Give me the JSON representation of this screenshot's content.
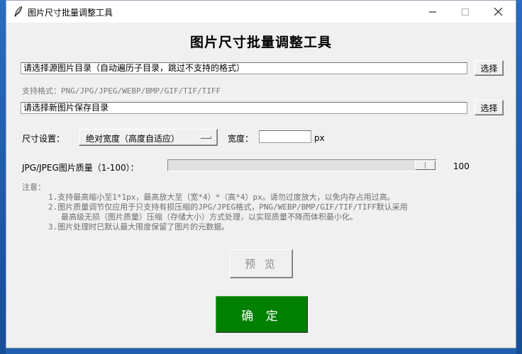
{
  "window": {
    "title": "图片尺寸批量调整工具"
  },
  "main": {
    "title": "图片尺寸批量调整工具",
    "source": {
      "value": "请选择源图片目录（自动遍历子目录，跳过不支持的格式）",
      "button_label": "选择"
    },
    "formats_hint": "支持格式：PNG/JPG/JPEG/WEBP/BMP/GIF/TIF/TIFF",
    "target": {
      "value": "请选择新图片保存目录",
      "button_label": "选择"
    },
    "size": {
      "label": "尺寸设置：",
      "mode_selected": "绝对宽度（高度自适应）",
      "width_label": "宽度：",
      "width_value": "",
      "unit": "px"
    },
    "quality": {
      "label": "JPG/JPEG图片质量（1-100）：",
      "value": 100,
      "min": 1,
      "max": 100,
      "value_text": "100"
    },
    "notes": {
      "heading": "注意：",
      "lines": [
        "1.支持最高缩小至1*1px，最高放大至（宽*4）*（高*4）px。请勿过度放大，以免内存占用过高。",
        "2.图片质量调节仅应用于只支持有损压缩的JPG/JPEG格式，PNG/WEBP/BMP/GIF/TIF/TIFF默认采用",
        "最高级无损（图片质量）压缩（存储大小）方式处理，以实现质量不降而体积最小化。",
        "3.图片处理时已默认最大限度保留了图片的元数据。"
      ]
    },
    "preview_label": "预 览",
    "ok_label": "确 定"
  },
  "colors": {
    "ok_button": "#008000",
    "window_bg": "#f0f0f0",
    "hint_text": "#7a7a7a"
  }
}
